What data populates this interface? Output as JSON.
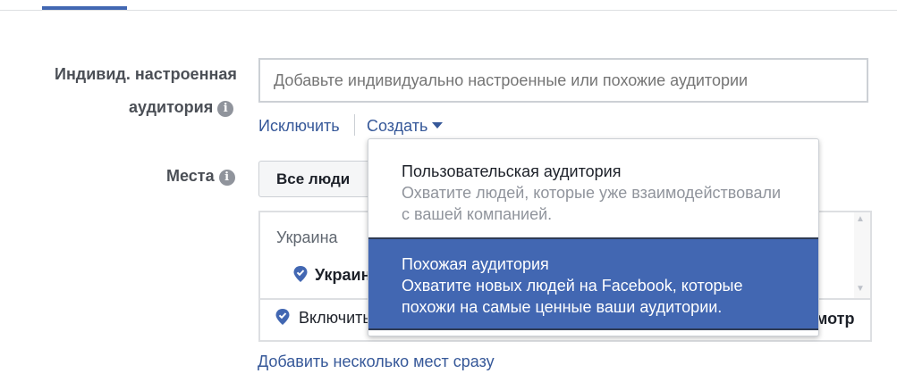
{
  "custom_audience": {
    "label_line1": "Индивид. настроенная",
    "label_line2": "аудитория",
    "placeholder": "Добавьте индивидуально настроенные или похожие аудитории",
    "exclude_link": "Исключить",
    "create_link": "Создать"
  },
  "places": {
    "label": "Места",
    "people_selector": "Все люди",
    "list_header": "Украина",
    "selected_country": "Украин",
    "include_label": "Включить",
    "browse_label": "мотр",
    "add_multiple_link": "Добавить несколько мест сразу"
  },
  "create_menu": {
    "items": [
      {
        "title": "Пользовательская аудитория",
        "description": "Охватите людей, которые уже взаимодействовали с вашей компанией."
      },
      {
        "title": "Похожая аудитория",
        "description": "Охватите новых людей на Facebook, которые похожи на самые ценные ваши аудитории."
      }
    ]
  },
  "colors": {
    "accent": "#4267b2",
    "link": "#365899",
    "muted": "#90949c"
  }
}
